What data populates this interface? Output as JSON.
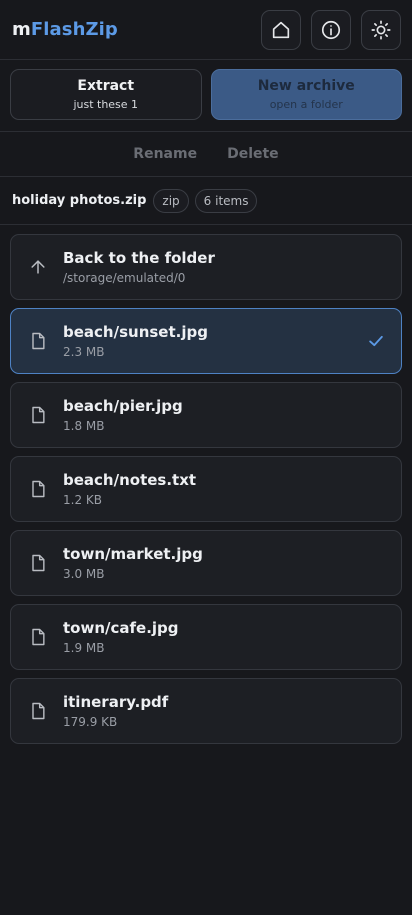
{
  "brand": {
    "prefix": "m",
    "name": "FlashZip"
  },
  "header": {
    "icons": [
      "home-icon",
      "info-icon",
      "sun-icon"
    ]
  },
  "actions": {
    "extract": {
      "label": "Extract",
      "sub": "just these 1"
    },
    "new_archive": {
      "label": "New archive",
      "sub": "open a folder"
    },
    "rename": "Rename",
    "delete": "Delete"
  },
  "archive": {
    "name": "holiday photos.zip",
    "format": "zip",
    "count": "6 items"
  },
  "back": {
    "title": "Back to the folder",
    "path": "/storage/emulated/0"
  },
  "files": [
    {
      "name": "beach/sunset.jpg",
      "size": "2.3 MB",
      "selected": true
    },
    {
      "name": "beach/pier.jpg",
      "size": "1.8 MB",
      "selected": false
    },
    {
      "name": "beach/notes.txt",
      "size": "1.2 KB",
      "selected": false
    },
    {
      "name": "town/market.jpg",
      "size": "3.0 MB",
      "selected": false
    },
    {
      "name": "town/cafe.jpg",
      "size": "1.9 MB",
      "selected": false
    },
    {
      "name": "itinerary.pdf",
      "size": "179.9 KB",
      "selected": false
    }
  ],
  "colors": {
    "accent": "#5c9ae6",
    "background": "#17181c",
    "selected_border": "#4e82c4",
    "primary_button": "#3b5a86"
  }
}
